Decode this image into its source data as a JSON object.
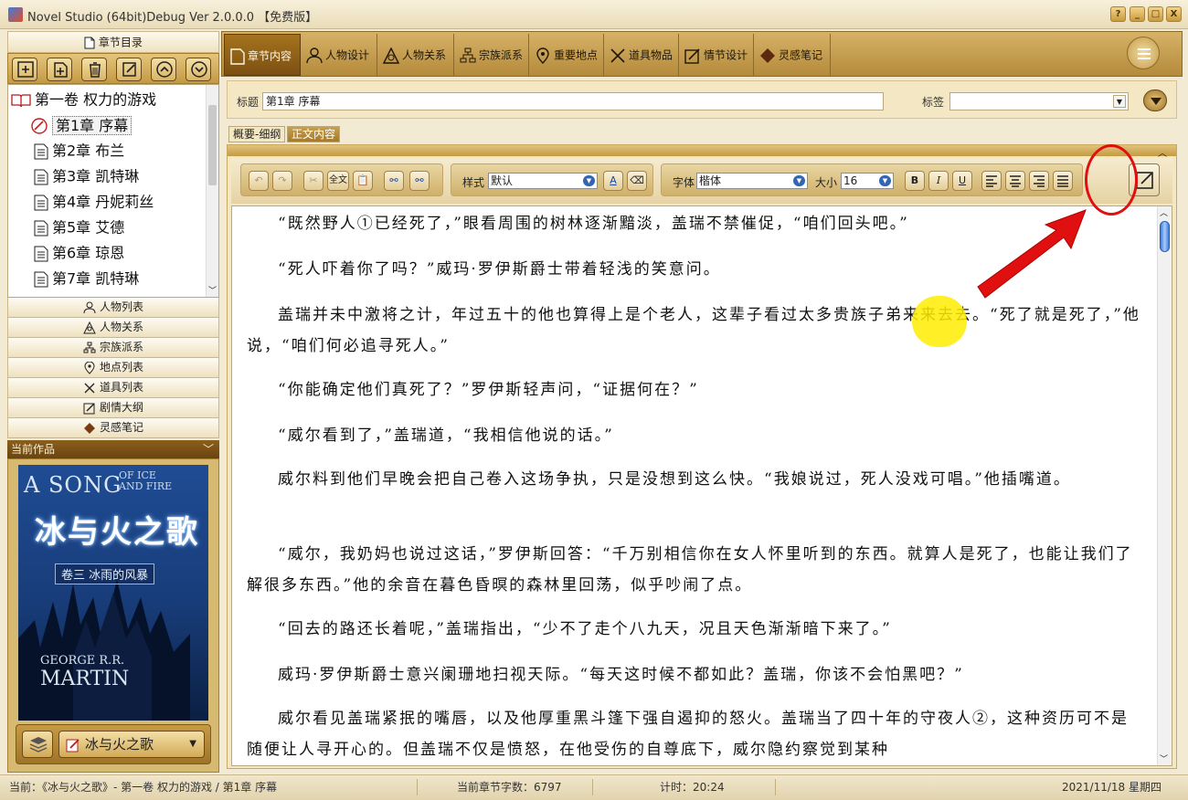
{
  "window": {
    "title": "Novel Studio (64bit)Debug Ver 2.0.0.0 【免费版】",
    "buttons": [
      "?",
      "_",
      "□",
      "X"
    ]
  },
  "left_panel": {
    "header_label": "章节目录",
    "toolbar": [
      "add-volume",
      "add-chapter",
      "delete",
      "edit",
      "move-up",
      "move-down"
    ],
    "tree": {
      "volume": "第一卷 权力的游戏",
      "chapters": [
        "第1章 序幕",
        "第2章 布兰",
        "第3章 凯特琳",
        "第4章 丹妮莉丝",
        "第5章 艾德",
        "第6章 琼恩",
        "第7章 凯特琳"
      ],
      "selected_index": 0
    },
    "nav_items": [
      {
        "label": "人物列表",
        "icon": "person-icon"
      },
      {
        "label": "人物关系",
        "icon": "relations-icon"
      },
      {
        "label": "宗族派系",
        "icon": "org-icon"
      },
      {
        "label": "地点列表",
        "icon": "location-icon"
      },
      {
        "label": "道具列表",
        "icon": "swords-icon"
      },
      {
        "label": "剧情大纲",
        "icon": "outline-icon"
      },
      {
        "label": "灵感笔记",
        "icon": "diamond-icon"
      }
    ],
    "current_work": {
      "header": "当前作品",
      "cover": {
        "title_en_main": "A SONG",
        "title_en_small_1": "OF ICE",
        "title_en_small_2": "AND FIRE",
        "title_cn": "冰与火之歌",
        "subtitle": "卷三 冰雨的风暴",
        "author_first": "GEORGE R.R.",
        "author_last": "MARTIN"
      },
      "work_name": "冰与火之歌"
    }
  },
  "tabs": [
    {
      "label": "章节内容",
      "icon": "doc-icon",
      "active": true
    },
    {
      "label": "人物设计",
      "icon": "person-icon",
      "active": false
    },
    {
      "label": "人物关系",
      "icon": "relations-icon",
      "active": false
    },
    {
      "label": "宗族派系",
      "icon": "org-icon",
      "active": false
    },
    {
      "label": "重要地点",
      "icon": "location-icon",
      "active": false
    },
    {
      "label": "道具物品",
      "icon": "swords-icon",
      "active": false
    },
    {
      "label": "情节设计",
      "icon": "outline-icon",
      "active": false
    },
    {
      "label": "灵感笔记",
      "icon": "diamond-icon",
      "active": false
    }
  ],
  "editor": {
    "title_label": "标题",
    "title_value": "第1章 序幕",
    "tag_label": "标签",
    "tag_value": "",
    "subtabs": [
      {
        "label": "概要-细纲",
        "active": false
      },
      {
        "label": "正文内容",
        "active": true
      }
    ],
    "format": {
      "style_label": "样式",
      "style_value": "默认",
      "font_label": "字体",
      "font_value": "楷体",
      "size_label": "大小",
      "size_value": "16",
      "text_buttons": [
        "全文",
        "B",
        "I",
        "U"
      ]
    },
    "paragraphs": [
      "“既然野人①已经死了，”眼看周围的树林逐渐黯淡，盖瑞不禁催促，“咱们回头吧。”",
      "“死人吓着你了吗？”威玛·罗伊斯爵士带着轻浅的笑意问。",
      "盖瑞并未中激将之计，年过五十的他也算得上是个老人，这辈子看过太多贵族子弟来来去去。“死了就是死了，”他说，“咱们何必追寻死人。”",
      "“你能确定他们真死了？”罗伊斯轻声问，“证据何在？”",
      "“威尔看到了，”盖瑞道，“我相信他说的话。”",
      "威尔料到他们早晚会把自己卷入这场争执，只是没想到这么快。“我娘说过，死人没戏可唱。”他插嘴道。",
      "“威尔，我奶妈也说过这话，”罗伊斯回答：“千万别相信你在女人怀里听到的东西。就算人是死了，也能让我们了解很多东西。”他的余音在暮色昏暝的森林里回荡，似乎吵闹了点。",
      "“回去的路还长着呢，”盖瑞指出，“少不了走个八九天，况且天色渐渐暗下来了。”",
      "威玛·罗伊斯爵士意兴阑珊地扫视天际。“每天这时候不都如此？盖瑞，你该不会怕黑吧？”",
      "威尔看见盖瑞紧抿的嘴唇，以及他厚重黑斗篷下强自遏抑的怒火。盖瑞当了四十年的守夜人②，这种资历可不是随便让人寻开心的。但盖瑞不仅是愤怒，在他受伤的自尊底下，威尔隐约察觉到某种"
    ]
  },
  "status": {
    "current": "当前：《冰与火之歌》- 第一卷 权力的游戏 / 第1章 序幕",
    "word_count": "当前章节字数：6797",
    "timer": "计时：20:24",
    "date": "2021/11/18 星期四"
  },
  "colors": {
    "accent_gold": "#c49a44",
    "active_tab": "#8a5a16",
    "annotation_red": "#e01010",
    "cursor_highlight": "#ffec00"
  }
}
